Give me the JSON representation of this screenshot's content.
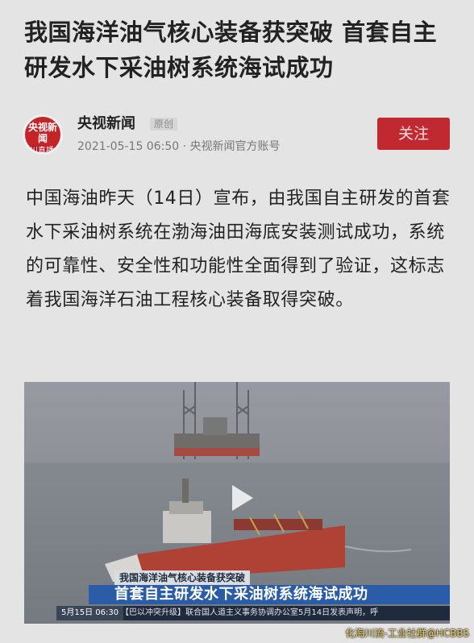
{
  "article": {
    "headline": "我国海洋油气核心装备获突破 首套自主研发水下采油树系统海试成功",
    "author": {
      "avatar_text": "央视新闻",
      "live_badge": "川直播",
      "name": "央视新闻",
      "original_tag": "原创",
      "meta": "2021-05-15 06:50 · 央视新闻官方账号",
      "follow_label": "关注"
    },
    "body": "中国海油昨天（14日）宣布，由我国自主研发的首套水下采油树系统在渤海油田海底安装测试成功，系统的可靠性、安全性和功能性全面得到了验证，这标志着我国海洋石油工程核心装备取得突破。"
  },
  "video": {
    "play_icon": "play-icon",
    "lower_third": {
      "topic": "我国海洋油气核心装备获突破",
      "headline": "首套自主研发水下采油树系统海试成功",
      "date": "5月15日 06:30",
      "ticker": "【巴以冲突升级】联合国人道主义事务协调办公室5月14日发表声明，呼"
    }
  },
  "watermark": "化海川流-工业社群@HCBBS",
  "colors": {
    "accent": "#c0292f",
    "brand": "#c32329",
    "headline_bar": "#2b5ca8"
  }
}
